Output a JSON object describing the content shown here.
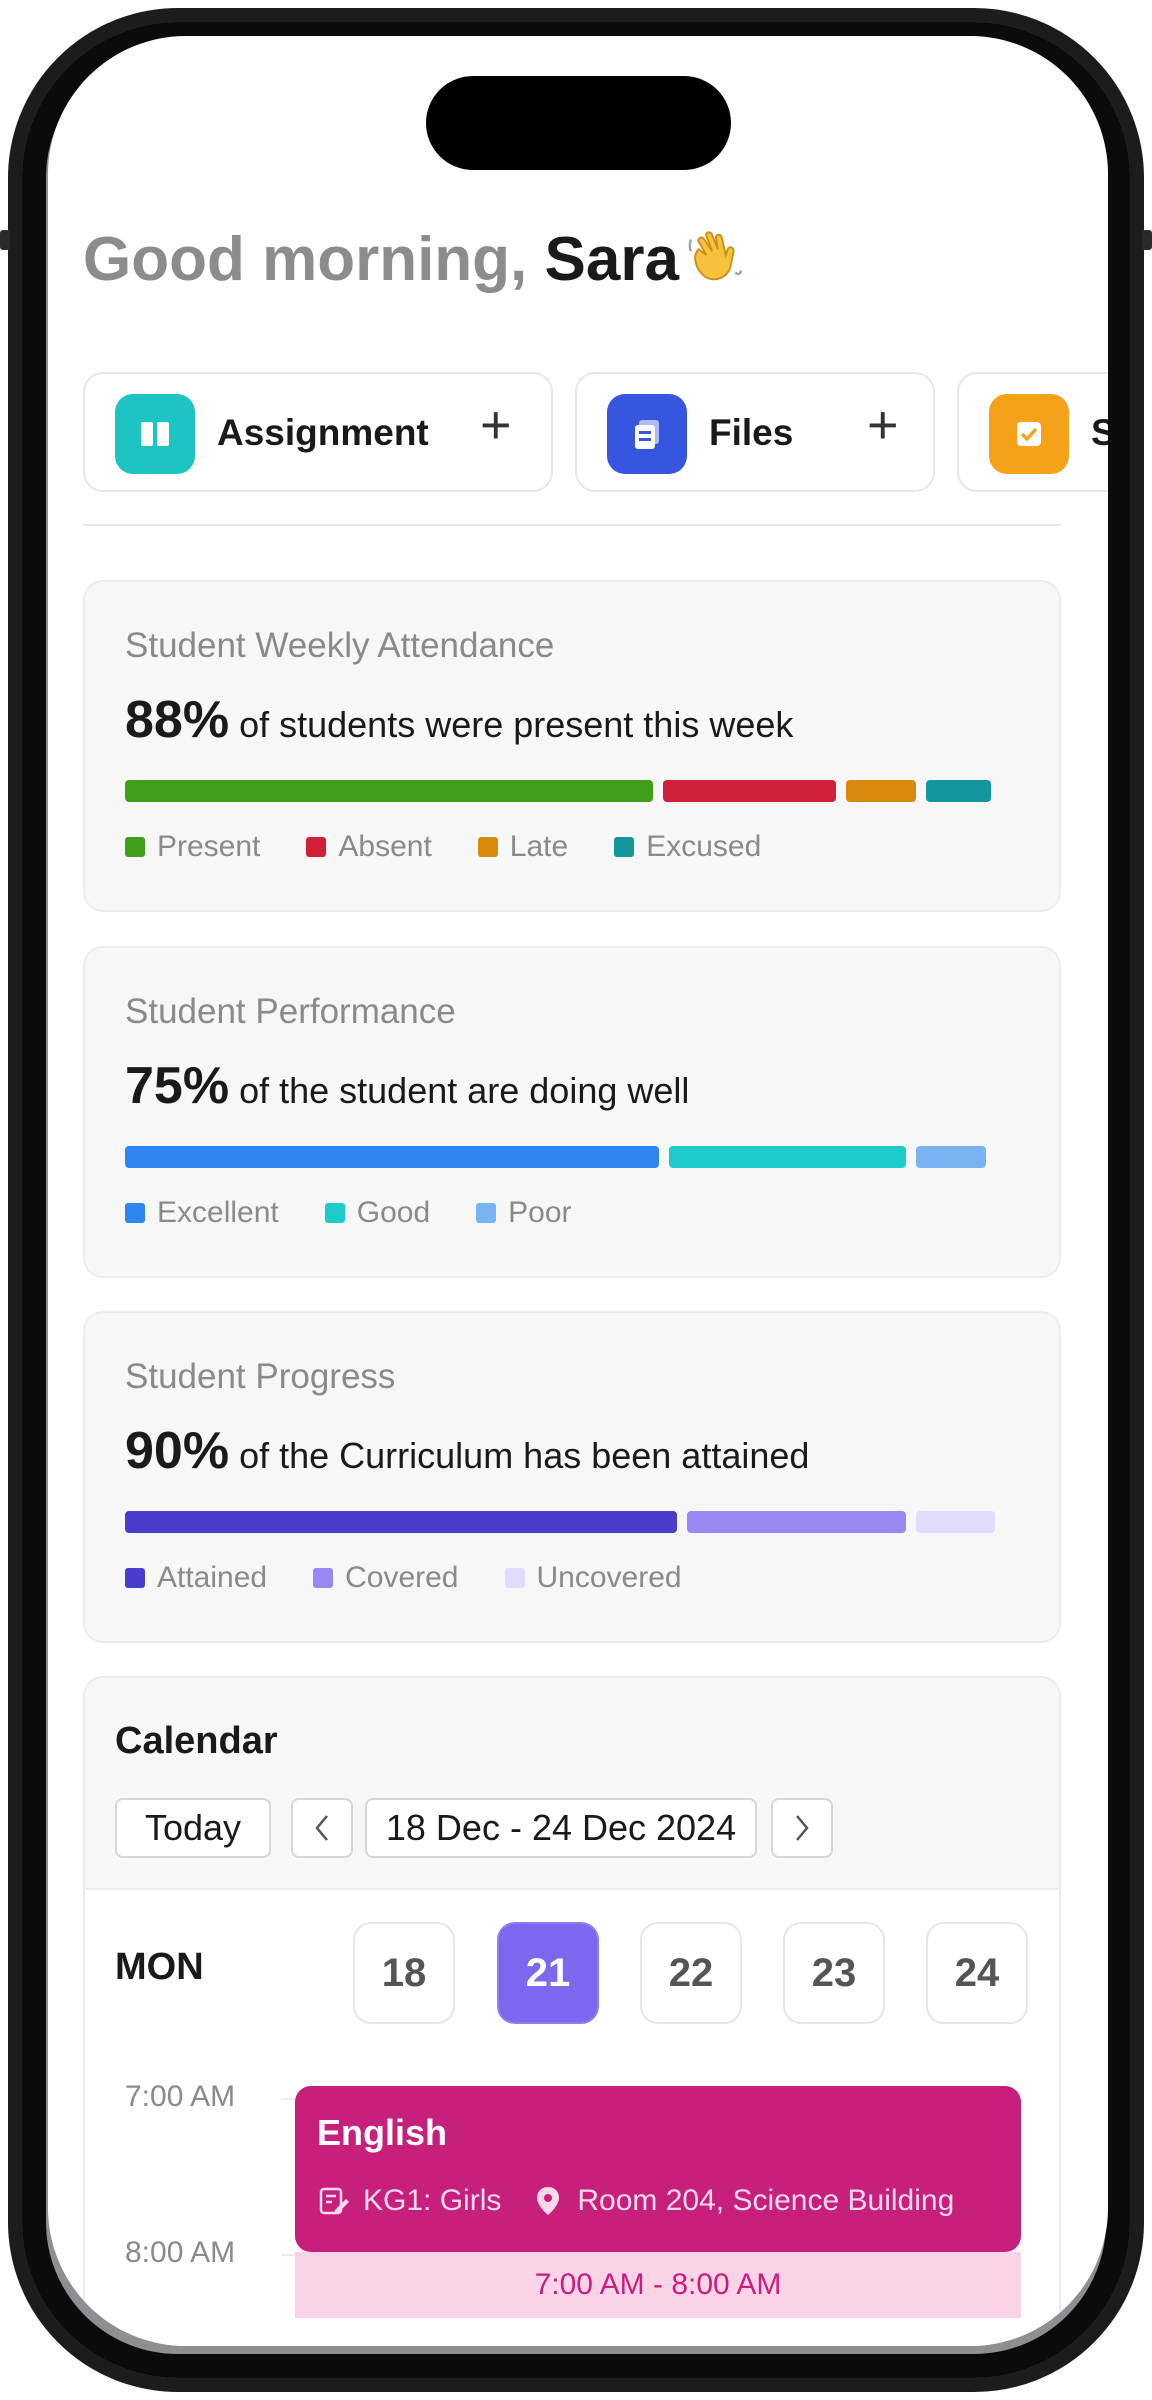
{
  "greeting": {
    "prefix": "Good morning, ",
    "name": "Sara"
  },
  "quick_actions": [
    {
      "label": "Assignment",
      "color": "#1ec3c3",
      "icon": "book-open-icon"
    },
    {
      "label": "Files",
      "color": "#3656e0",
      "icon": "files-icon"
    },
    {
      "label": "S",
      "color": "#f5a21b",
      "icon": "checkbox-icon"
    }
  ],
  "attendance": {
    "title": "Student Weekly Attendance",
    "percent": "88%",
    "text": " of students were present this week",
    "segments": [
      {
        "label": "Present",
        "color": "#3f9e1a",
        "share": 0.61
      },
      {
        "label": "Absent",
        "color": "#d01f38",
        "share": 0.2
      },
      {
        "label": "Late",
        "color": "#d88a0e",
        "share": 0.08
      },
      {
        "label": "Excused",
        "color": "#13969c",
        "share": 0.075
      }
    ]
  },
  "performance": {
    "title": "Student Performance",
    "percent": "75%",
    "text": " of the student are doing well",
    "segments": [
      {
        "label": "Excellent",
        "color": "#2f86f0",
        "share": 0.61
      },
      {
        "label": "Good",
        "color": "#1ccbca",
        "share": 0.27
      },
      {
        "label": "Poor",
        "color": "#78b3f2",
        "share": 0.08
      }
    ]
  },
  "progress": {
    "title": "Student Progress",
    "percent": "90%",
    "text": " of the Curriculum has been attained",
    "segments": [
      {
        "label": "Attained",
        "color": "#4a3ccc",
        "share": 0.63
      },
      {
        "label": "Covered",
        "color": "#988af2",
        "share": 0.25
      },
      {
        "label": "Uncovered",
        "color": "#e0dcfb",
        "share": 0.09
      }
    ]
  },
  "calendar": {
    "title": "Calendar",
    "today_label": "Today",
    "range": "18 Dec - 24 Dec 2024",
    "day": "MON",
    "dates": [
      "18",
      "21",
      "22",
      "23",
      "24"
    ],
    "selected_date": "21",
    "times": [
      "7:00 AM",
      "8:00 AM"
    ],
    "event": {
      "name": "English",
      "class": "KG1: Girls",
      "location": "Room 204, Science Building",
      "time": "7:00 AM - 8:00 AM"
    }
  }
}
